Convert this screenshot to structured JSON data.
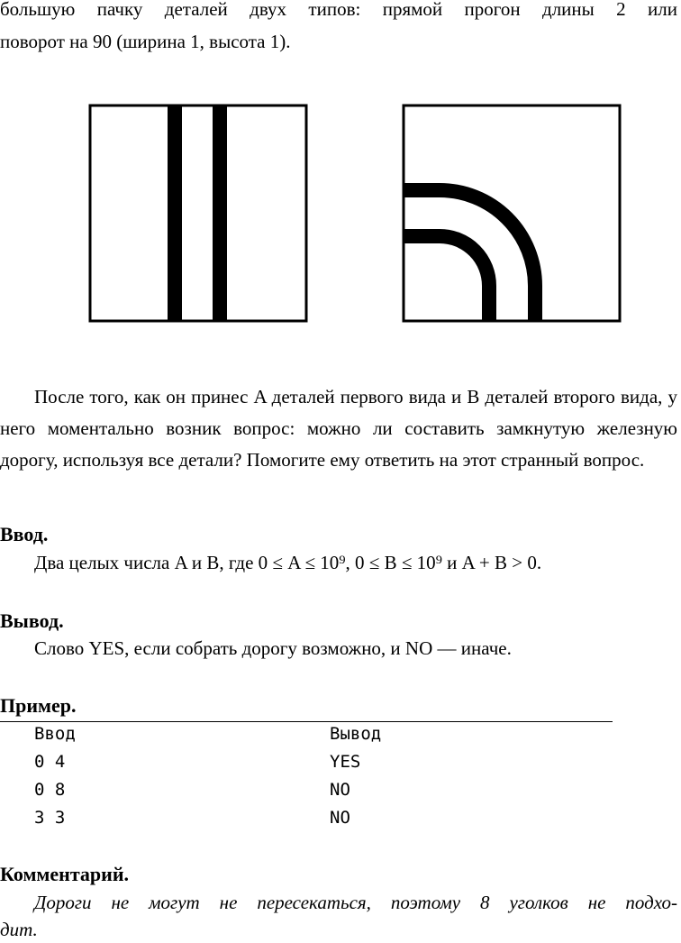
{
  "intro": {
    "line1": "большую пачку деталей двух типов: прямой прогон длины 2 или",
    "line2": "поворот на 90 (ширина 1, высота 1)."
  },
  "figures": {
    "left": "straight-track-piece",
    "right": "curved-track-piece"
  },
  "statement": "После того, как он принес A деталей первого вида и B деталей второго вида, у него моментально возник вопрос: можно ли составить замкнутую железную дорогу, используя все детали? Помогите ему ответить на этот странный вопрос.",
  "input": {
    "heading": "Ввод.",
    "text": "Два целых числа A и B, где 0 ≤ A ≤ 10⁹, 0 ≤ B ≤ 10⁹ и A + B > 0."
  },
  "output": {
    "heading": "Вывод.",
    "text": "Слово YES, если собрать дорогу возможно, и NO — иначе."
  },
  "example": {
    "heading": "Пример.",
    "col_input": "Ввод",
    "col_output": "Вывод",
    "rows": [
      {
        "in": "0 4",
        "out": "YES"
      },
      {
        "in": "0 8",
        "out": "NO"
      },
      {
        "in": "3 3",
        "out": "NO"
      }
    ]
  },
  "comment": {
    "heading": "Комментарий.",
    "line1": "Дороги не могут не пересекаться, поэтому 8 уголков не подхо-",
    "line2": "дит."
  }
}
